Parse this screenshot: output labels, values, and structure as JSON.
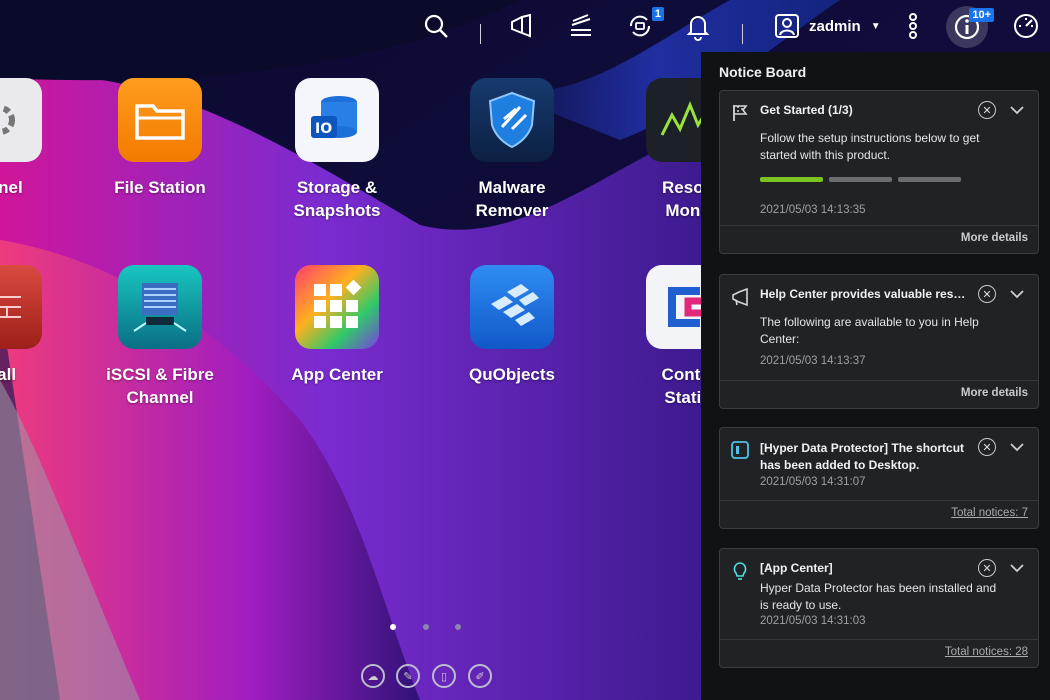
{
  "topbar": {
    "icons": [
      "search-icon",
      "megaphone-icon",
      "task-stack-icon",
      "background-tasks-icon",
      "bell-icon"
    ],
    "background_tasks_count": "1",
    "username": "zadmin",
    "notice_count": "10+"
  },
  "apps": [
    {
      "label": "Panel"
    },
    {
      "label": "File Station"
    },
    {
      "label": "Storage &\nSnapshots"
    },
    {
      "label": "Malware\nRemover"
    },
    {
      "label": "Resou\nMonit"
    },
    {
      "label": "wall"
    },
    {
      "label": "iSCSI & Fibre\nChannel"
    },
    {
      "label": "App Center"
    },
    {
      "label": "QuObjects"
    },
    {
      "label": "Contai\nStatio"
    }
  ],
  "notice_board": {
    "title": "Notice Board",
    "cards": [
      {
        "title": "Get Started (1/3)",
        "body": "Follow the setup instructions below to get started with this product.",
        "time": "2021/05/03 14:13:35",
        "footer": "More details",
        "progress_done": 1,
        "progress_total": 3
      },
      {
        "title": "Help Center provides valuable resources",
        "body": "The following are available to you in Help Center:",
        "time": "2021/05/03 14:13:37",
        "footer": "More details"
      },
      {
        "title": "[Hyper Data Protector] The shortcut has been added to Desktop.",
        "time": "2021/05/03 14:31:07",
        "footer": "Total notices: 7"
      },
      {
        "title": "[App Center]",
        "body": "Hyper Data Protector has been installed and is ready to use.",
        "time": "2021/05/03 14:31:03",
        "footer": "Total notices: 28"
      }
    ]
  },
  "colors": {
    "progress_active": "#7cc31f",
    "progress_inactive": "#6b6d72",
    "badge": "#1a73e8"
  }
}
